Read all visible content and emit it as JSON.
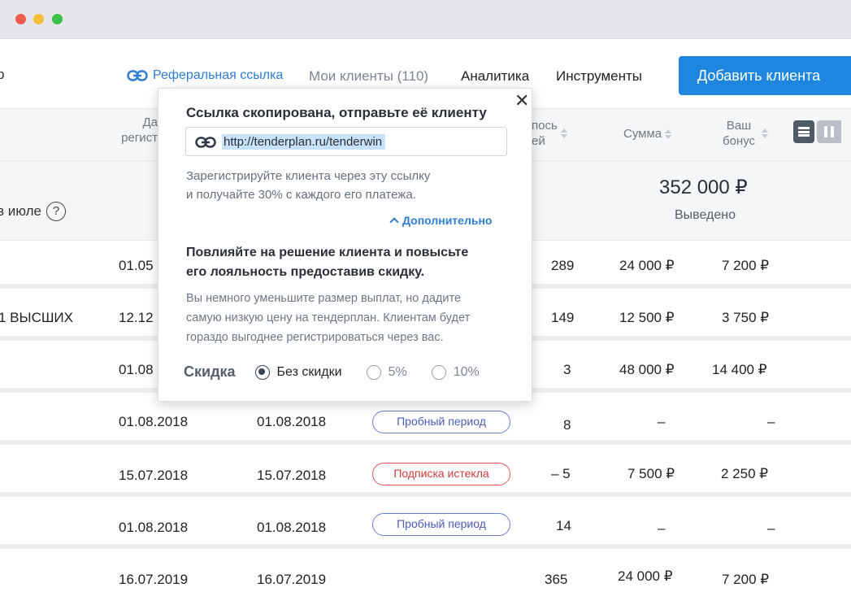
{
  "nav": {
    "cut_text": "р",
    "referral_label": "Реферальная ссылка",
    "clients_label": "Мои клиенты (110)",
    "analytics_label": "Аналитика",
    "tools_label": "Инструменты",
    "add_client_label": "Добавить клиента"
  },
  "table_header": {
    "date_line1": "Да",
    "date_line2": "регист",
    "days_line1": "пось",
    "days_line2": "ей",
    "sum_label": "Сумма",
    "bonus_line1": "Ваш",
    "bonus_line2": "бонус"
  },
  "summary": {
    "label": "в июле",
    "help_glyph": "?",
    "amount": "352 000 ₽",
    "caption": "Выведено"
  },
  "rows": [
    {
      "name": "",
      "date1": "01.05",
      "date2": "",
      "status": "",
      "days": "289",
      "sum": "24 000 ₽",
      "bonus": "7 200 ₽"
    },
    {
      "name": "1 ВЫСШИХ",
      "date1": "12.12",
      "date2": "",
      "status": "",
      "days": "149",
      "sum": "12 500 ₽",
      "bonus": "3 750 ₽"
    },
    {
      "name": "",
      "date1": "01.08",
      "date2": "",
      "status": "",
      "days": "3",
      "sum": "48 000 ₽",
      "bonus": "14 400 ₽"
    },
    {
      "name": "",
      "date1": "01.08.2018",
      "date2": "01.08.2018",
      "status": "Пробный период",
      "days": "8",
      "sum": "–",
      "bonus": "–"
    },
    {
      "name": "",
      "date1": "15.07.2018",
      "date2": "15.07.2018",
      "status": "Подписка истекла",
      "days": "– 5",
      "sum": "7 500 ₽",
      "bonus": "2 250 ₽"
    },
    {
      "name": "",
      "date1": "01.08.2018",
      "date2": "01.08.2018",
      "status": "Пробный период",
      "days": "14",
      "sum": "–",
      "bonus": "–"
    },
    {
      "name": "",
      "date1": "16.07.2019",
      "date2": "16.07.2019",
      "status": "",
      "days": "365",
      "sum": "24 000 ₽",
      "bonus": "7 200 ₽"
    }
  ],
  "popup": {
    "close_glyph": "✕",
    "title": "Ссылка скопирована, отправьте её клиенту",
    "link": "http://tenderplan.ru/tenderwin",
    "desc_line1": "Зарегистрируйте клиента через эту ссылку",
    "desc_line2": "и получайте 30% с каждого его платежа.",
    "more_label": "Дополнительно",
    "bold_line1": "Повлияйте на решение клиента и повысьте",
    "bold_line2": "его лояльность предоставив скидку.",
    "note_line1": "Вы немного уменьшите размер выплат, но дадите",
    "note_line2": "самую низкую цену на тендерплан. Клиентам будет",
    "note_line3": "гораздо выгоднее регистрироваться через вас.",
    "discount_label": "Скидка",
    "options": [
      "Без скидки",
      "5%",
      "10%"
    ],
    "selected": "Без скидки"
  },
  "colors": {
    "accent": "#1f86e0",
    "link": "#2f7dd3",
    "trial_badge": "#6e7cd6",
    "expired_badge": "#e45454"
  }
}
